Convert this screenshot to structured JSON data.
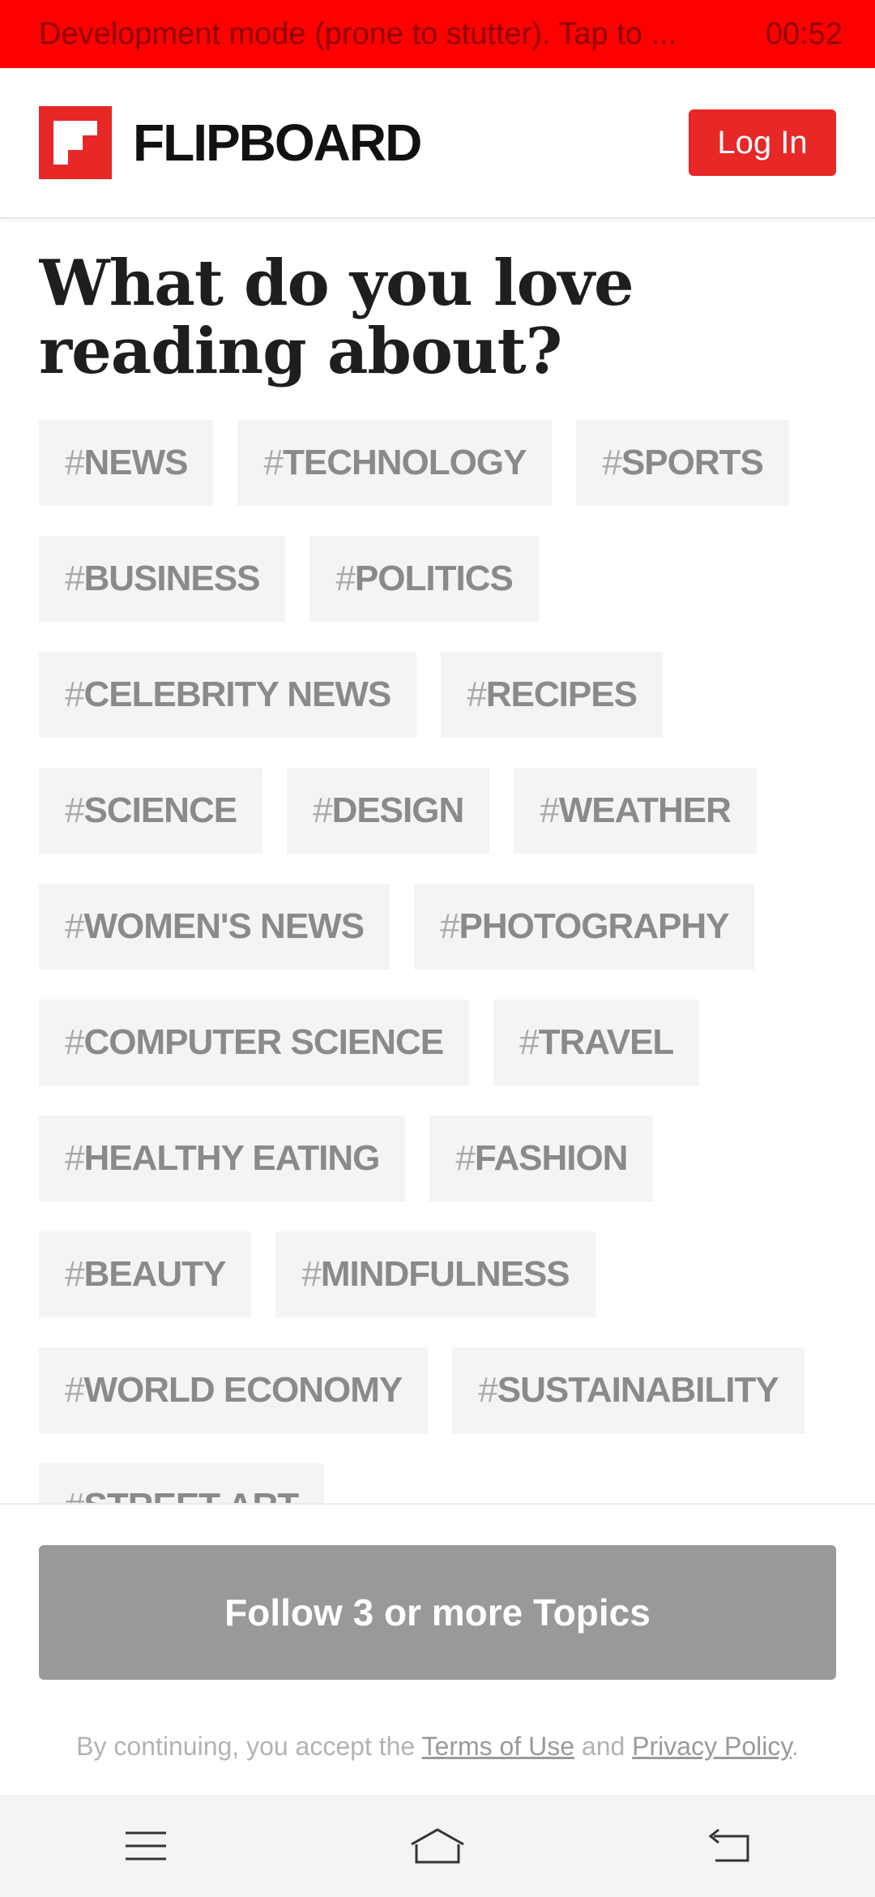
{
  "dev_banner": {
    "message": "Development mode (prone to stutter). Tap to ...",
    "time": "00:52"
  },
  "header": {
    "brand": "FLIPBOARD",
    "login_label": "Log In",
    "accent_color": "#e82727"
  },
  "main": {
    "title": "What do you love reading about?",
    "topics": [
      {
        "label": "NEWS"
      },
      {
        "label": "TECHNOLOGY"
      },
      {
        "label": "SPORTS"
      },
      {
        "label": "BUSINESS"
      },
      {
        "label": "POLITICS"
      },
      {
        "label": "CELEBRITY NEWS"
      },
      {
        "label": "RECIPES"
      },
      {
        "label": "SCIENCE"
      },
      {
        "label": "DESIGN"
      },
      {
        "label": "WEATHER"
      },
      {
        "label": "WOMEN'S NEWS"
      },
      {
        "label": "PHOTOGRAPHY"
      },
      {
        "label": "COMPUTER SCIENCE"
      },
      {
        "label": "TRAVEL"
      },
      {
        "label": "HEALTHY EATING"
      },
      {
        "label": "FASHION"
      },
      {
        "label": "BEAUTY"
      },
      {
        "label": "MINDFULNESS"
      },
      {
        "label": "WORLD ECONOMY"
      },
      {
        "label": "SUSTAINABILITY"
      },
      {
        "label": "STREET ART"
      }
    ]
  },
  "footer": {
    "follow_label": "Follow 3 or more Topics",
    "terms_prefix": "By continuing, you accept the ",
    "terms_link": "Terms of Use",
    "terms_and": " and ",
    "privacy_link": "Privacy Policy",
    "terms_suffix": "."
  },
  "navbar": {
    "icons": [
      "menu-icon",
      "home-icon",
      "back-icon"
    ]
  }
}
